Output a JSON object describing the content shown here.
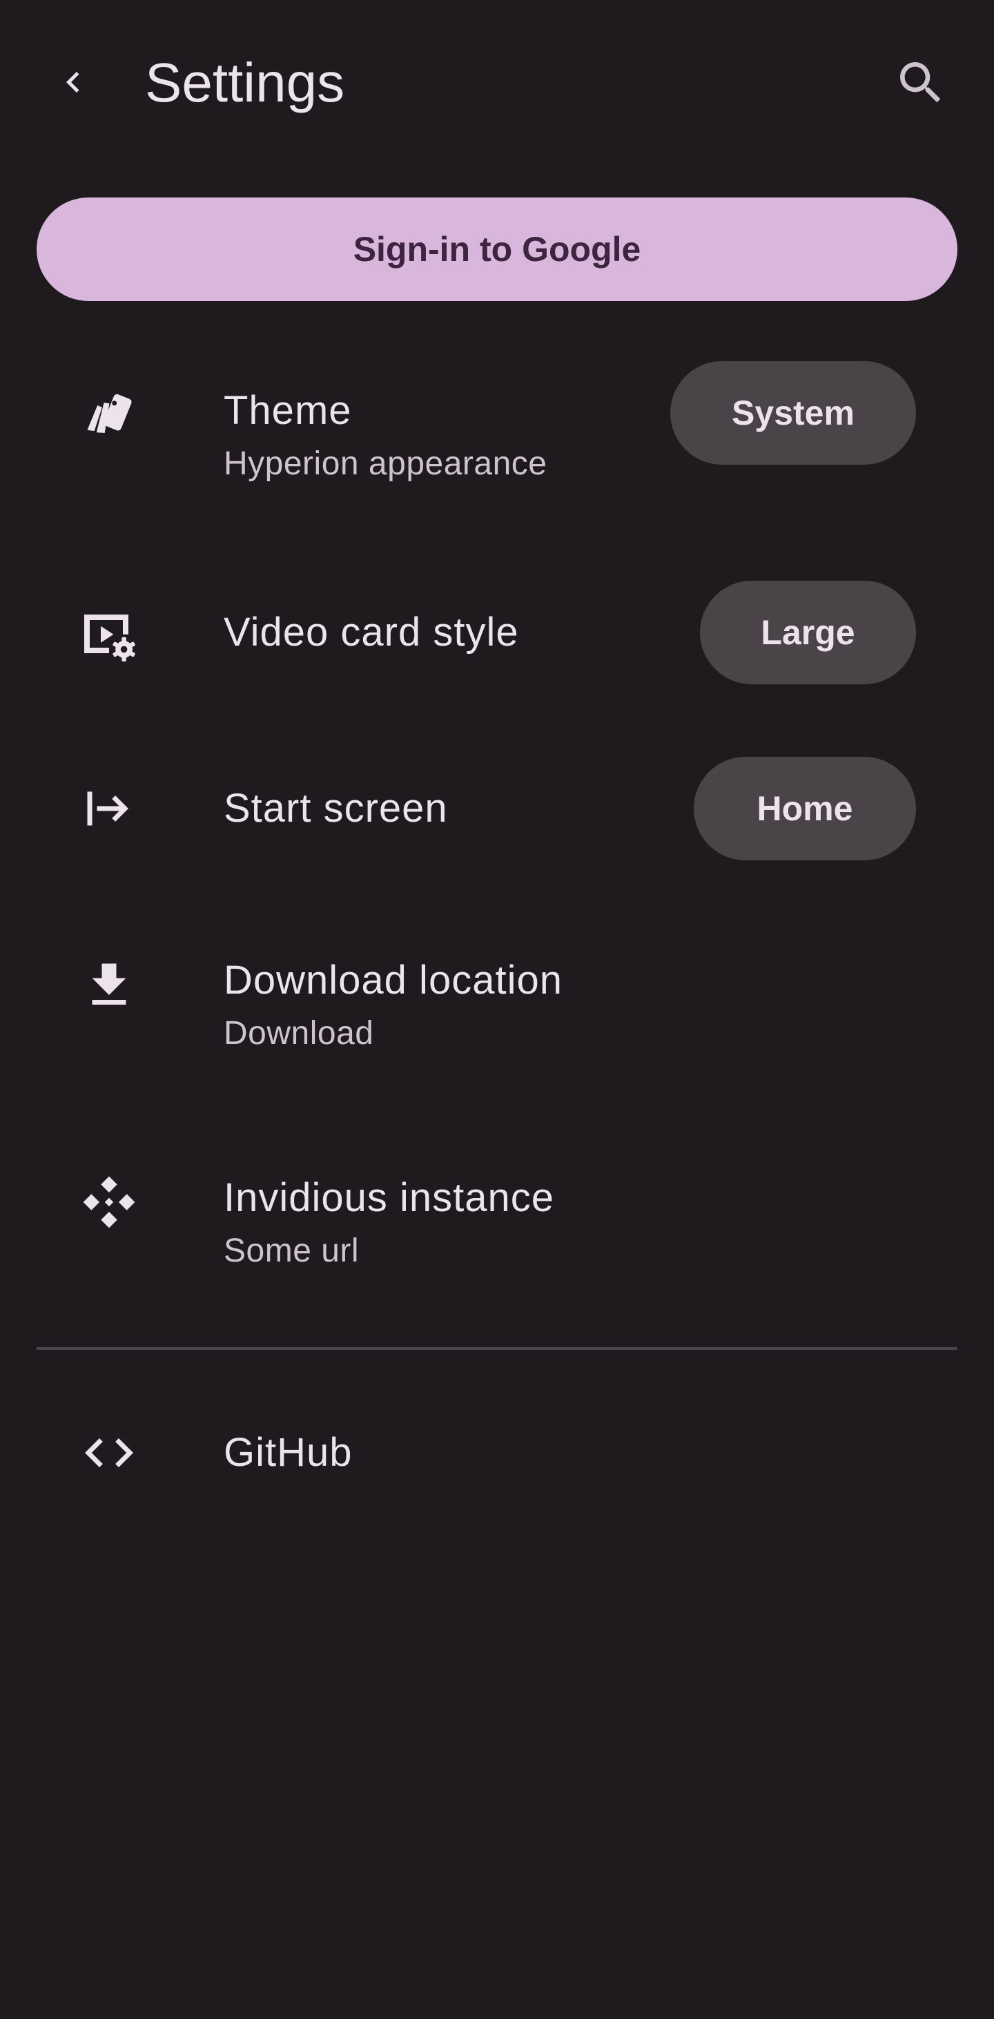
{
  "header": {
    "title": "Settings",
    "back_icon": "back-arrow-icon",
    "search_icon": "search-icon"
  },
  "signin": {
    "label": "Sign-in to Google"
  },
  "settings": [
    {
      "icon": "theme-swatch-icon",
      "title": "Theme",
      "subtitle": "Hyperion appearance",
      "value": "System"
    },
    {
      "icon": "video-settings-icon",
      "title": "Video card style",
      "value": "Large"
    },
    {
      "icon": "start-arrow-icon",
      "title": "Start screen",
      "value": "Home"
    },
    {
      "icon": "download-icon",
      "title": "Download location",
      "subtitle": "Download"
    },
    {
      "icon": "instance-network-icon",
      "title": "Invidious instance",
      "subtitle": "Some url"
    }
  ],
  "links": [
    {
      "icon": "code-icon",
      "title": "GitHub"
    }
  ],
  "colors": {
    "background": "#1e1a1e",
    "primary_button": "#d9b6db",
    "primary_button_text": "#3d2540",
    "chip": "#4a4449",
    "text": "#ece4ea",
    "subtext": "#cfc4cd",
    "divider": "#4a454a"
  }
}
